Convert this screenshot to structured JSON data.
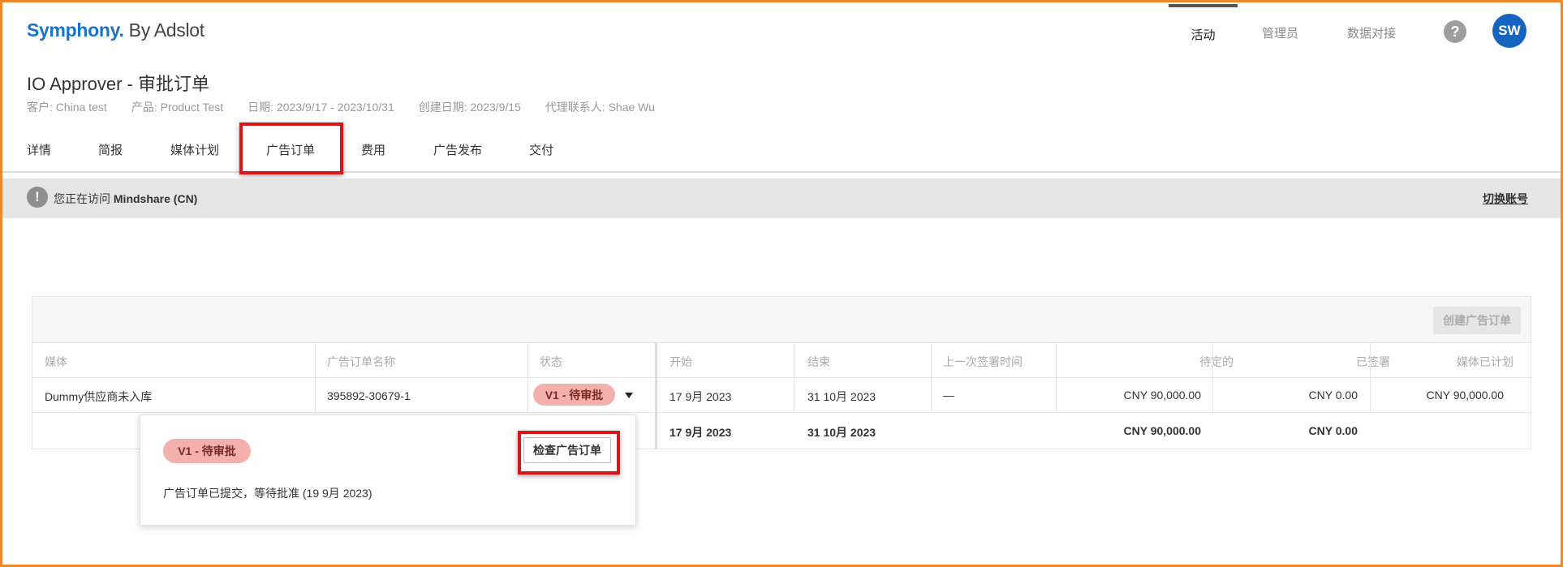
{
  "header": {
    "logo_brand": "Symphony.",
    "logo_suffix": "By Adslot",
    "nav": [
      {
        "label": "活动"
      },
      {
        "label": "管理员"
      },
      {
        "label": "数据对接"
      }
    ],
    "help_icon": "?",
    "avatar_initials": "SW"
  },
  "page": {
    "title": "IO Approver - 审批订单",
    "meta": {
      "client": "客户: China test",
      "product": "产品: Product Test",
      "dates": "日期: 2023/9/17 - 2023/10/31",
      "created": "创建日期: 2023/9/15",
      "agent": "代理联系人: Shae Wu"
    }
  },
  "tabs": [
    {
      "label": "详情"
    },
    {
      "label": "简报"
    },
    {
      "label": "媒体计划"
    },
    {
      "label": "广告订单"
    },
    {
      "label": "费用"
    },
    {
      "label": "广告发布"
    },
    {
      "label": "交付"
    }
  ],
  "banner": {
    "icon": "!",
    "prefix": "您正在访问",
    "account": "Mindshare (CN)",
    "switch_label": "切换账号"
  },
  "panel": {
    "create_button": "创建广告订单",
    "left_headers": [
      "媒体",
      "广告订单名称",
      "状态"
    ],
    "right_headers": [
      "开始",
      "结束",
      "上一次签署时间",
      "待定的",
      "已签署",
      "媒体已计划"
    ],
    "row": {
      "media": "Dummy供应商未入库",
      "order_name": "395892-30679-1",
      "status": "V1 - 待审批",
      "start": "17 9月 2023",
      "end": "31 10月 2023",
      "last_signed": "—",
      "pending": "CNY 90,000.00",
      "signed": "CNY 0.00",
      "planned": "CNY 90,000.00"
    },
    "totals": {
      "start": "17 9月 2023",
      "end": "31 10月 2023",
      "pending": "CNY 90,000.00",
      "signed": "CNY 0.00"
    }
  },
  "popup": {
    "status": "V1 - 待审批",
    "check_button": "检查广告订单",
    "message": "广告订单已提交，等待批准 (19 9月 2023)"
  }
}
